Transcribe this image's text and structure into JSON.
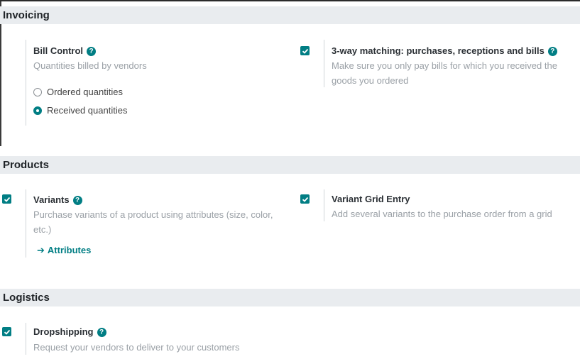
{
  "sections": {
    "invoicing": {
      "title": "Invoicing",
      "bill_control": {
        "title": "Bill Control",
        "description": "Quantities billed by vendors",
        "options": [
          "Ordered quantities",
          "Received quantities"
        ],
        "selected": "Received quantities"
      },
      "three_way": {
        "title": "3-way matching: purchases, receptions and bills",
        "description": "Make sure you only pay bills for which you received the goods you ordered",
        "checked": true
      }
    },
    "products": {
      "title": "Products",
      "variants": {
        "title": "Variants",
        "description": "Purchase variants of a product using attributes (size, color, etc.)",
        "checked": true,
        "link": "Attributes"
      },
      "variant_grid": {
        "title": "Variant Grid Entry",
        "description": "Add several variants to the purchase order from a grid",
        "checked": true
      }
    },
    "logistics": {
      "title": "Logistics",
      "dropshipping": {
        "title": "Dropshipping",
        "description": "Request your vendors to deliver to your customers",
        "checked": true
      }
    }
  },
  "icons": {
    "help": "question-circle-icon",
    "check": "check-icon",
    "arrow": "arrow-right-icon"
  },
  "colors": {
    "accent": "#017e84",
    "header_bg": "#e9ecef",
    "muted_text": "#9aa0a6"
  }
}
